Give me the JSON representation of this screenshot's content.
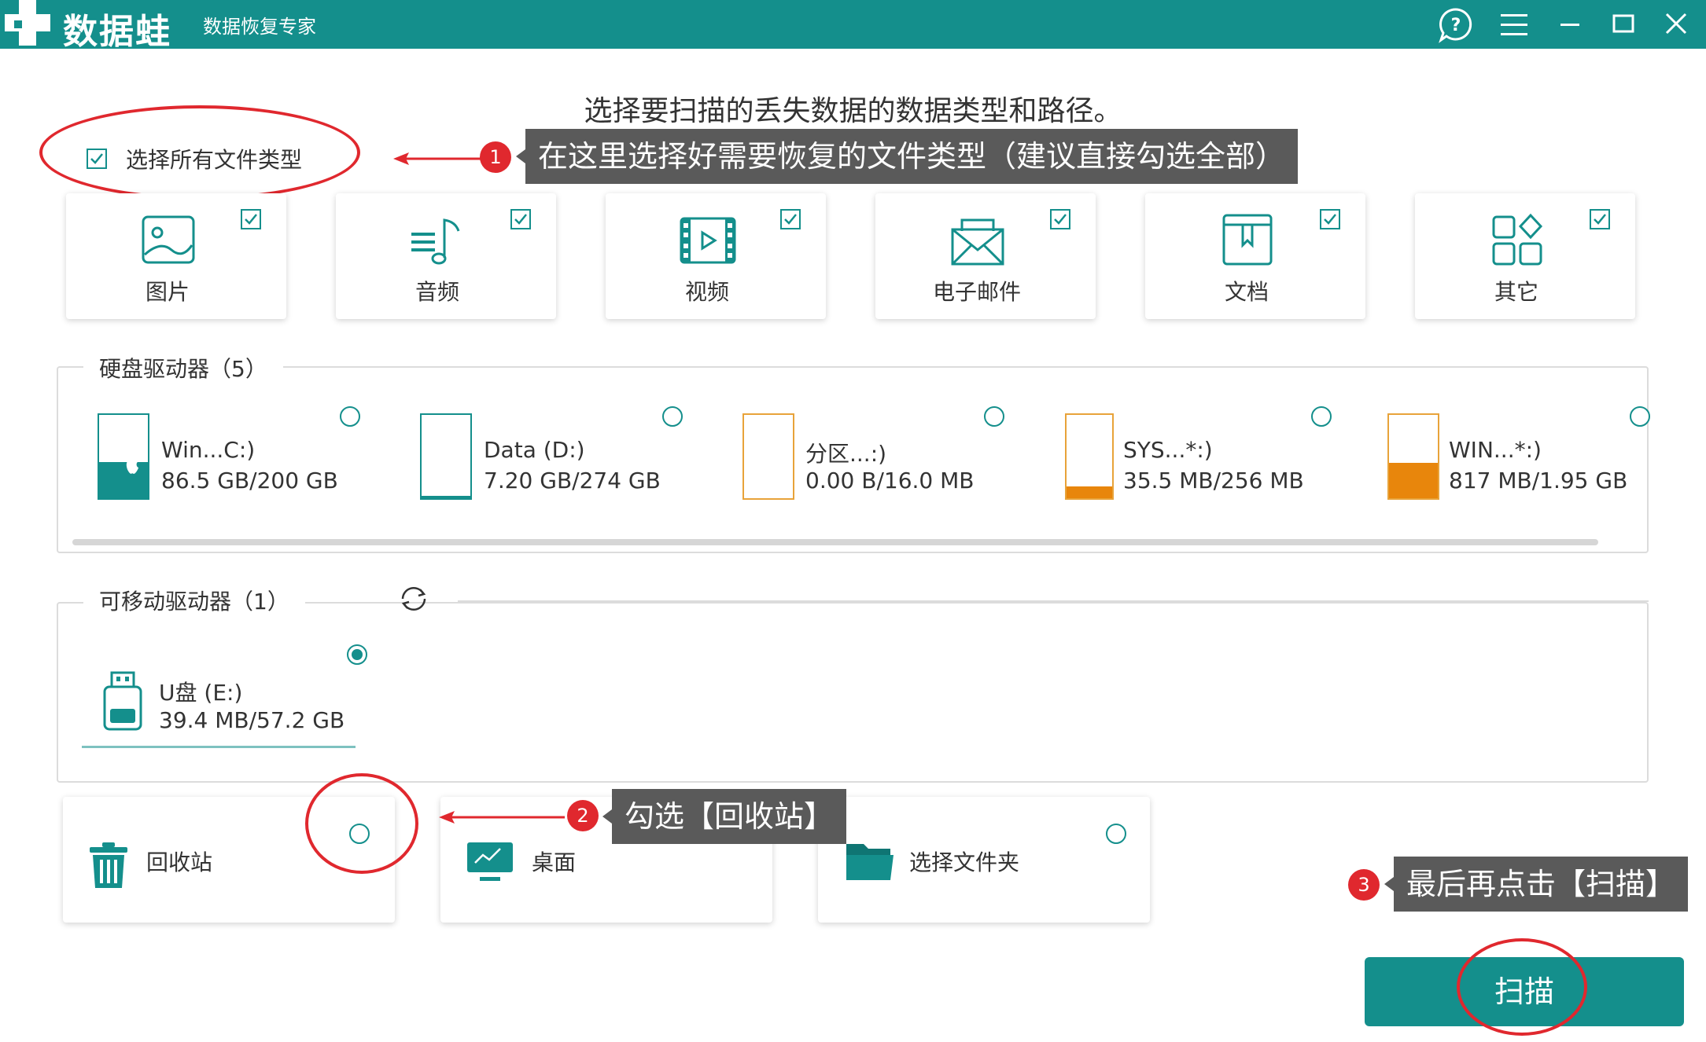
{
  "app": {
    "logo": "数据蛙",
    "subtitle": "数据恢复专家"
  },
  "titlebar_icons": [
    "help-icon",
    "menu-icon",
    "minimize-icon",
    "maximize-icon",
    "close-icon"
  ],
  "heading": "选择要扫描的丢失数据的数据类型和路径。",
  "select_all": {
    "label": "选择所有文件类型",
    "checked": true
  },
  "file_types": [
    {
      "label": "图片",
      "icon": "image-icon",
      "checked": true
    },
    {
      "label": "音频",
      "icon": "audio-icon",
      "checked": true
    },
    {
      "label": "视频",
      "icon": "video-icon",
      "checked": true
    },
    {
      "label": "电子邮件",
      "icon": "email-icon",
      "checked": true
    },
    {
      "label": "文档",
      "icon": "document-icon",
      "checked": true
    },
    {
      "label": "其它",
      "icon": "other-icon",
      "checked": true
    }
  ],
  "hard_drives": {
    "title": "硬盘驱动器（5）",
    "items": [
      {
        "name": "Win...C:)",
        "size": "86.5 GB/200 GB",
        "used_fraction": 0.43,
        "color": "#148f8c"
      },
      {
        "name": "Data (D:)",
        "size": "7.20 GB/274 GB",
        "used_fraction": 0.03,
        "color": "#148f8c"
      },
      {
        "name": "分区...:)",
        "size": "0.00  B/16.0 MB",
        "used_fraction": 0.0,
        "color": "#e8a33a"
      },
      {
        "name": "SYS...*:)",
        "size": "35.5 MB/256 MB",
        "used_fraction": 0.14,
        "color": "#e8860c"
      },
      {
        "name": "WIN...*:)",
        "size": "817 MB/1.95 GB",
        "used_fraction": 0.42,
        "color": "#e8860c"
      }
    ]
  },
  "removable_drives": {
    "title": "可移动驱动器（1）",
    "items": [
      {
        "name": "U盘 (E:)",
        "size": "39.4 MB/57.2 GB",
        "selected": true
      }
    ]
  },
  "locations": [
    {
      "label": "回收站",
      "icon": "trash-icon",
      "selected": false
    },
    {
      "label": "桌面",
      "icon": "desktop-icon",
      "selected": false
    },
    {
      "label": "选择文件夹",
      "icon": "folder-icon",
      "selected": false
    }
  ],
  "annotations": [
    {
      "number": "1",
      "text": "在这里选择好需要恢复的文件类型（建议直接勾选全部）"
    },
    {
      "number": "2",
      "text": "勾选【回收站】"
    },
    {
      "number": "3",
      "text": "最后再点击【扫描】"
    }
  ],
  "scan_button": "扫描",
  "colors": {
    "primary": "#148f8c",
    "annotation_red": "#e0282e",
    "tooltip_bg": "#5a5a5a"
  }
}
